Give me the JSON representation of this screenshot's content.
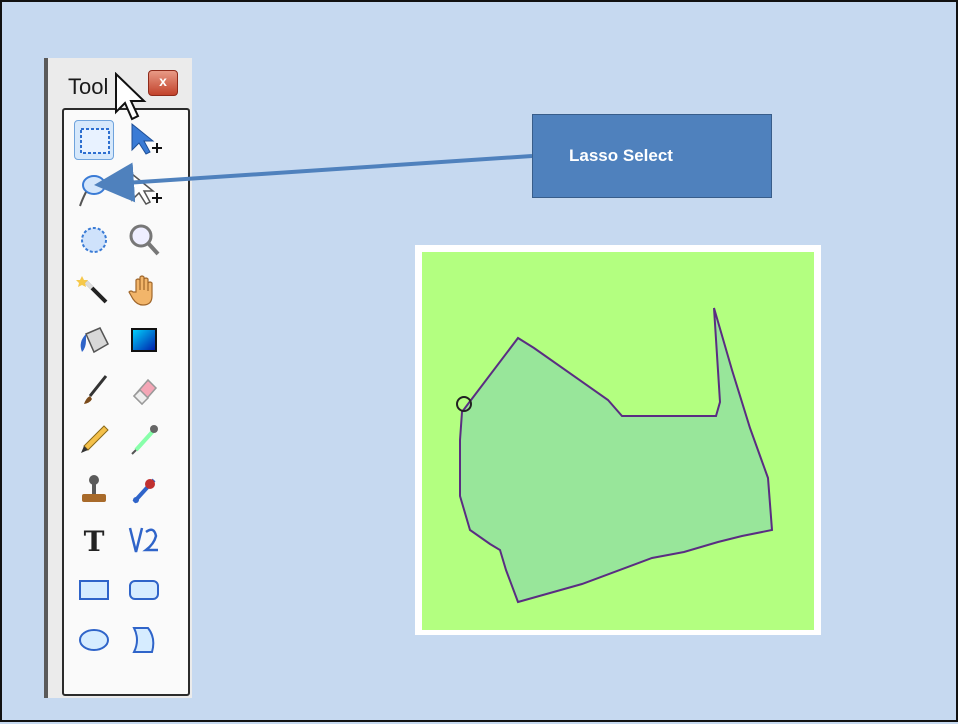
{
  "tools_window": {
    "title": "Tool",
    "close_glyph": "x",
    "tools": [
      {
        "name": "rectangle-select-icon",
        "active": true
      },
      {
        "name": "move-selection-icon",
        "active": false
      },
      {
        "name": "lasso-select-icon",
        "active": false
      },
      {
        "name": "move-selected-icon",
        "active": false
      },
      {
        "name": "ellipse-select-icon",
        "active": false
      },
      {
        "name": "zoom-icon",
        "active": false
      },
      {
        "name": "magic-wand-icon",
        "active": false
      },
      {
        "name": "pan-hand-icon",
        "active": false
      },
      {
        "name": "paint-bucket-icon",
        "active": false
      },
      {
        "name": "gradient-icon",
        "active": false
      },
      {
        "name": "paintbrush-icon",
        "active": false
      },
      {
        "name": "eraser-icon",
        "active": false
      },
      {
        "name": "pencil-icon",
        "active": false
      },
      {
        "name": "color-picker-icon",
        "active": false
      },
      {
        "name": "clone-stamp-icon",
        "active": false
      },
      {
        "name": "recolor-icon",
        "active": false
      },
      {
        "name": "text-icon",
        "active": false
      },
      {
        "name": "line-curve-icon",
        "active": false
      },
      {
        "name": "rectangle-shape-icon",
        "active": false
      },
      {
        "name": "rounded-rectangle-icon",
        "active": false
      },
      {
        "name": "ellipse-shape-icon",
        "active": false
      },
      {
        "name": "freeform-shape-icon",
        "active": false
      }
    ]
  },
  "callout": {
    "label": "Lasso Select"
  },
  "colors": {
    "slide_bg": "#c6d9f0",
    "callout_fill": "#4f81bd",
    "canvas_bg": "#b3ff80",
    "selection_fill": "#98e69a",
    "selection_outline": "#5a2d82"
  }
}
